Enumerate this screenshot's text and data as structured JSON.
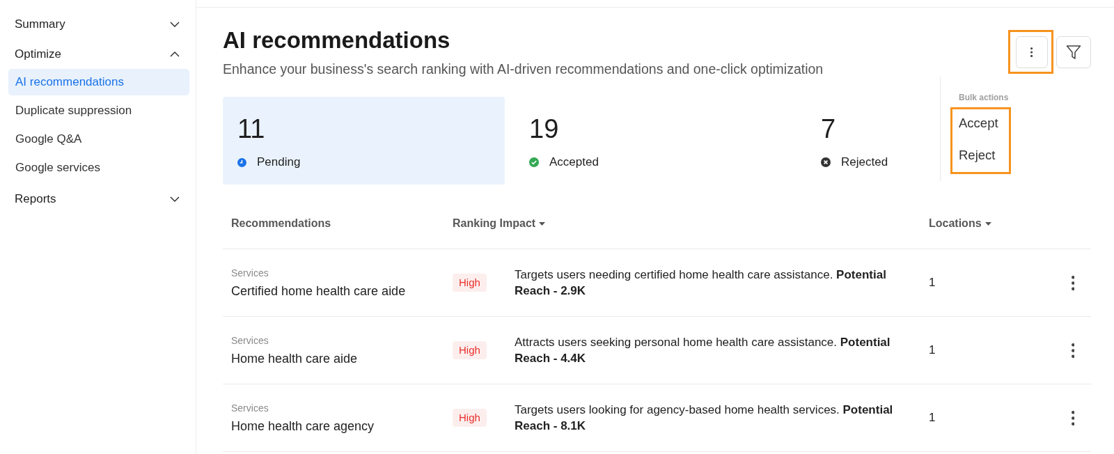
{
  "sidebar": {
    "sections": [
      {
        "label": "Summary",
        "expanded": false
      },
      {
        "label": "Optimize",
        "expanded": true,
        "items": [
          {
            "label": "AI recommendations",
            "selected": true
          },
          {
            "label": "Duplicate suppression",
            "selected": false
          },
          {
            "label": "Google Q&A",
            "selected": false
          },
          {
            "label": "Google services",
            "selected": false
          }
        ]
      },
      {
        "label": "Reports",
        "expanded": false
      }
    ]
  },
  "header": {
    "title": "AI recommendations",
    "subtitle": "Enhance your business's search ranking with AI-driven recommendations and one-click optimization"
  },
  "toolbar": {
    "buttons": [
      {
        "kind": "more",
        "highlighted": true
      },
      {
        "kind": "filter",
        "highlighted": false
      }
    ]
  },
  "stats": [
    {
      "kind": "pending",
      "count": "11",
      "label": "Pending",
      "selected": true
    },
    {
      "kind": "accepted",
      "count": "19",
      "label": "Accepted",
      "selected": false
    },
    {
      "kind": "rejected",
      "count": "7",
      "label": "Rejected",
      "selected": false
    }
  ],
  "bulk_actions_menu": {
    "title": "Bulk actions",
    "highlighted": true,
    "items": [
      "Accept",
      "Reject"
    ]
  },
  "table": {
    "columns": [
      {
        "label": "Recommendations",
        "sortable": false
      },
      {
        "label": "Ranking Impact",
        "sortable": true
      },
      {
        "label": "Locations",
        "sortable": true
      }
    ],
    "rows": [
      {
        "category": "Services",
        "name": "Certified home health care aide",
        "impact": "High",
        "description": "Targets users needing certified home health care assistance. **Potential Reach - 2.9K**",
        "locations": "1"
      },
      {
        "category": "Services",
        "name": "Home health care aide",
        "impact": "High",
        "description": "Attracts users seeking personal home health care assistance. **Potential Reach - 4.4K**",
        "locations": "1"
      },
      {
        "category": "Services",
        "name": "Home health care agency",
        "impact": "High",
        "description": "Targets users looking for agency-based home health services. **Potential Reach - 8.1K**",
        "locations": "1"
      }
    ]
  }
}
